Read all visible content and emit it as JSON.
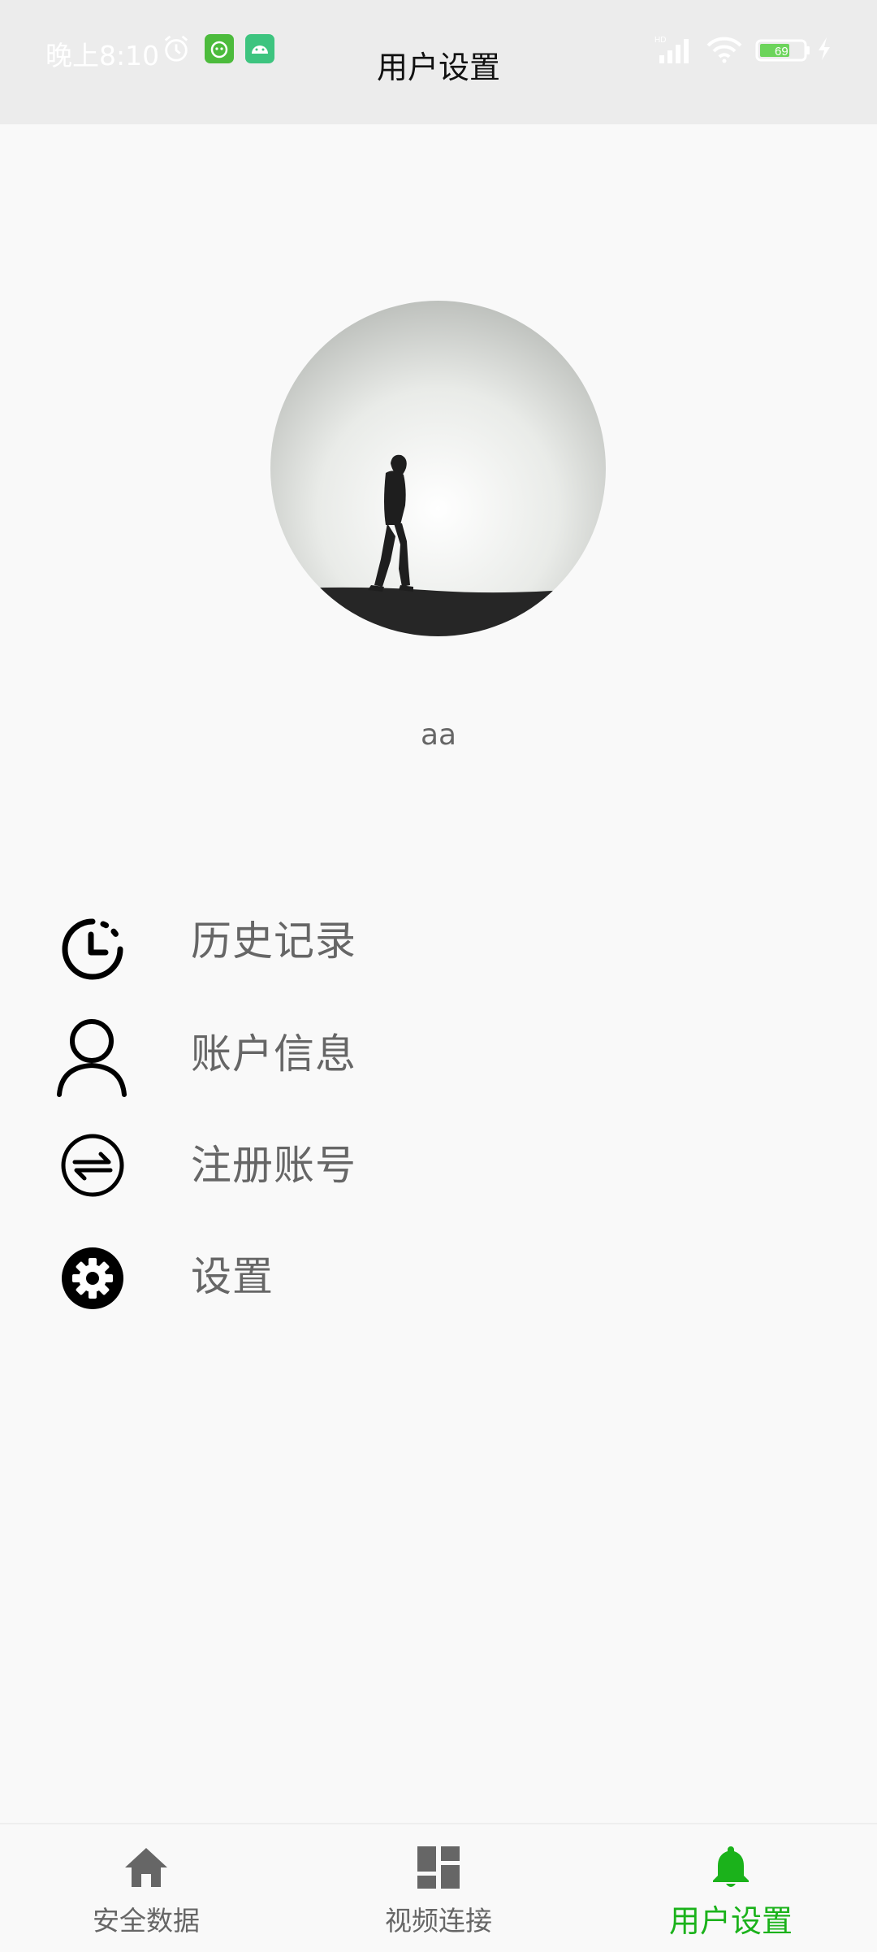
{
  "status_bar": {
    "time": "晚上8:10",
    "battery": "69"
  },
  "header": {
    "title": "用户设置"
  },
  "profile": {
    "username": "aa"
  },
  "menu": {
    "items": [
      {
        "label": "历史记录",
        "icon": "clock-icon"
      },
      {
        "label": "账户信息",
        "icon": "person-icon"
      },
      {
        "label": "注册账号",
        "icon": "switch-icon"
      },
      {
        "label": "设置",
        "icon": "gear-icon"
      }
    ]
  },
  "bottom_nav": {
    "items": [
      {
        "label": "安全数据",
        "icon": "home-icon",
        "active": false
      },
      {
        "label": "视频连接",
        "icon": "dashboard-icon",
        "active": false
      },
      {
        "label": "用户设置",
        "icon": "bell-icon",
        "active": true
      }
    ],
    "active_color": "#1bb21b",
    "inactive_color": "#666666"
  }
}
